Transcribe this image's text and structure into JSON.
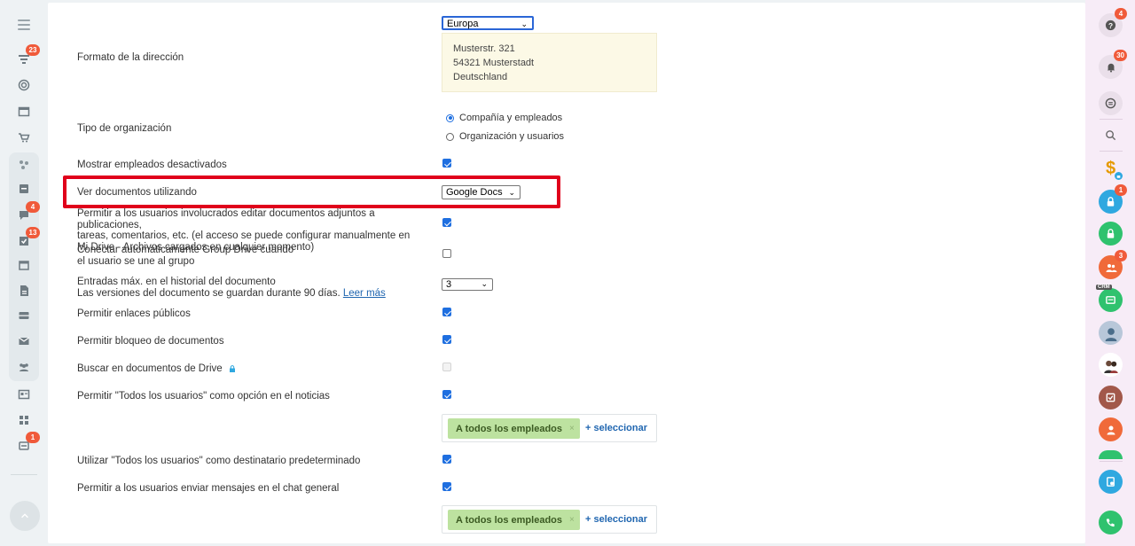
{
  "left_nav": {
    "badges": {
      "feed": "23",
      "chat": "4",
      "tasks": "13",
      "sync": "1"
    }
  },
  "settings": {
    "address_format": {
      "label": "Formato de la dirección",
      "selected": "Europa",
      "preview": [
        "Musterstr. 321",
        "54321 Musterstadt",
        "Deutschland"
      ]
    },
    "organization_type": {
      "label": "Tipo de organización",
      "options": [
        "Compañía y empleados",
        "Organización y usuarios"
      ],
      "selected_index": 0
    },
    "show_deactivated": {
      "label": "Mostrar empleados desactivados",
      "checked": true
    },
    "view_documents": {
      "label": "Ver documentos utilizando",
      "selected": "Google Docs"
    },
    "allow_edit_attachments": {
      "label_lines": [
        "Permitir a los usuarios involucrados editar documentos adjuntos a publicaciones,",
        "tareas, comentarios, etc. (el acceso se puede configurar manualmente en",
        "Mi Drive - Archivos cargados en cualquier momento)"
      ],
      "checked": true
    },
    "auto_connect_group_drive": {
      "label_lines": [
        "Conectar automáticamente Group Drive cuando",
        "el usuario se une al grupo"
      ],
      "checked": false
    },
    "history_entries": {
      "label_line1": "Entradas máx. en el historial del documento",
      "label_line2": "Las versiones del documento se guardan durante 90 días.",
      "link": "Leer más",
      "selected": "3"
    },
    "public_links": {
      "label": "Permitir enlaces públicos",
      "checked": true
    },
    "document_lock": {
      "label": "Permitir bloqueo de documentos",
      "checked": true
    },
    "drive_search": {
      "label": "Buscar en documentos de Drive",
      "checked": false,
      "disabled": true
    },
    "all_users_feed": {
      "label": "Permitir \"Todos los usuarios\" como opción en el noticias",
      "checked": true,
      "tag": "A todos los empleados",
      "tag_remove": "×",
      "add_label": "+ seleccionar"
    },
    "all_users_default": {
      "label": "Utilizar \"Todos los usuarios\" como destinatario predeterminado",
      "checked": true
    },
    "general_chat": {
      "label": "Permitir a los usuarios enviar mensajes en el chat general",
      "checked": true,
      "tag": "A todos los empleados",
      "tag_remove": "×",
      "add_label": "+ seleccionar"
    }
  },
  "right_bar": {
    "badges": {
      "help": "4",
      "notifications": "30",
      "lock": "1",
      "groups": "3"
    },
    "crm_label": "CRM",
    "dollar_sign": "$",
    "colors": {
      "green": "#2fc26e",
      "blue": "#2fa8e0",
      "orange": "#f06a3a",
      "brown": "#a2584a"
    }
  },
  "colors": {
    "highlight": "#e0001b",
    "accent": "#1f6fe0",
    "tag_bg": "#bde2a0",
    "address_bg": "#fcf9e6"
  }
}
